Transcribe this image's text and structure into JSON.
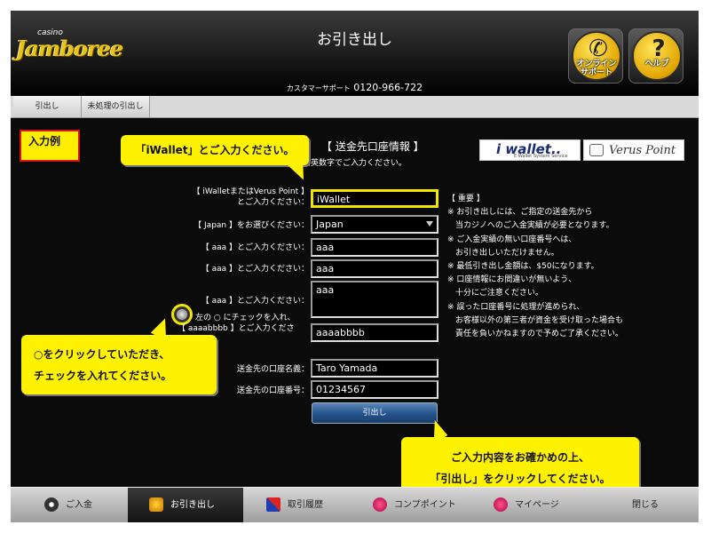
{
  "header": {
    "logo_small": "casino",
    "logo_main": "Jamboree",
    "title": "お引き出し",
    "support_label": "カスタマーサポート",
    "support_phone": "0120-966-722",
    "online_support_label": "オンライン\nサポート",
    "help_label": "ヘルプ"
  },
  "tabs": [
    "引出し",
    "未処理の引出し"
  ],
  "content": {
    "example_badge": "入力例",
    "section_title": "【 送金先口座情報 】",
    "section_note": "半角英数字でご入力ください。",
    "brands": {
      "iwallet": "i wallet..",
      "iwallet_sub": "E-Wallet System Service",
      "verus": "Verus Point"
    },
    "form": {
      "account_label_1": "【 iWalletまたはVerus Point 】",
      "account_label_2": "とご入力ください：",
      "account_value": "iWallet",
      "select_label": "【 Japan 】をお選びください：",
      "select_value": "Japan",
      "aaa_label_1": "【 aaa 】とご入力ください：",
      "aaa_value_1": "aaa",
      "aaa_label_2": "【 aaa 】とご入力ください：",
      "aaa_value_2": "aaa",
      "aaa_label_3": "【 aaa 】とご入力ください：",
      "aaa_value_3": "aaa",
      "check_label_1": "左の ○ にチェックを入れ、",
      "check_label_2": "【 aaaabbbb 】とご入力ください：",
      "check_value": "aaaabbbb",
      "name_label": "送金先の口座名義：",
      "name_value": "Taro Yamada",
      "number_label": "送金先の口座番号：",
      "number_value": "01234567",
      "submit_label": "引出し"
    },
    "notes": [
      "【 重要 】",
      "※ お引き出しには、ご指定の送金先から",
      "　当カジノへのご入金実績が必要となります。",
      "※ ご入金実績の無い口座番号へは、",
      "　お引き出しいただけません。",
      "※ 最低引き出し金額は、$50になります。",
      "※ 口座情報にお間違いが無いよう、",
      "　十分にご注意ください。",
      "※ 誤った口座番号に処理が進められ、",
      "　お客様以外の第三者が資金を受け取った場合も",
      "　責任を負いかねますので予めご了承ください。"
    ],
    "callouts": {
      "c1": "「iWallet」とご入力ください。",
      "c2_line1": "○をクリックしていただき、",
      "c2_line2": "チェックを入れてください。",
      "c3_line1": "ご入力内容をお確かめの上、",
      "c3_line2": "「引出し」をクリックしてください。"
    }
  },
  "bottom_nav": {
    "deposit": "ご入金",
    "withdraw": "お引き出し",
    "history": "取引履歴",
    "comp": "コンプポイント",
    "mypage": "マイページ",
    "close": "閉じる"
  },
  "icons": {
    "online_support": "phone-icon",
    "help": "question-icon"
  }
}
